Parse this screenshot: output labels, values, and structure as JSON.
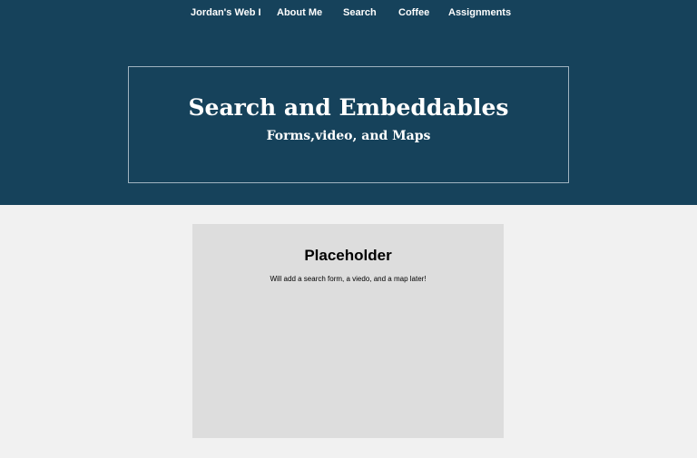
{
  "nav": {
    "items": [
      {
        "label": "Jordan's Web I"
      },
      {
        "label": "About Me"
      },
      {
        "label": "Search"
      },
      {
        "label": "Coffee"
      },
      {
        "label": "Assignments"
      }
    ]
  },
  "hero": {
    "title": "Search and Embeddables",
    "subtitle": "Forms,video, and Maps"
  },
  "card": {
    "heading": "Placeholder",
    "text": "Will add a search form, a viedo, and a map later!"
  },
  "colors": {
    "header": "#16425b",
    "card": "#dddddd",
    "page": "#f1f1f1"
  }
}
